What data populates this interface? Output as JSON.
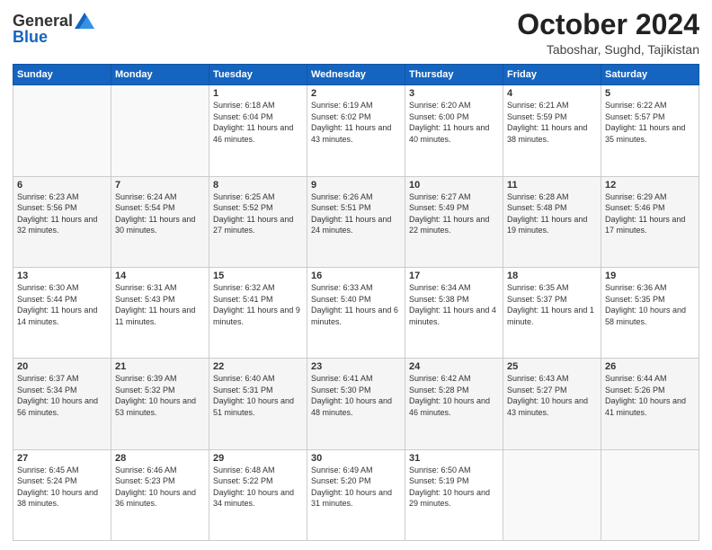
{
  "header": {
    "logo_general": "General",
    "logo_blue": "Blue",
    "title": "October 2024",
    "location": "Taboshar, Sughd, Tajikistan"
  },
  "days_of_week": [
    "Sunday",
    "Monday",
    "Tuesday",
    "Wednesday",
    "Thursday",
    "Friday",
    "Saturday"
  ],
  "weeks": [
    [
      {
        "day": null
      },
      {
        "day": null
      },
      {
        "day": 1,
        "sunrise": "6:18 AM",
        "sunset": "6:04 PM",
        "daylight": "11 hours and 46 minutes."
      },
      {
        "day": 2,
        "sunrise": "6:19 AM",
        "sunset": "6:02 PM",
        "daylight": "11 hours and 43 minutes."
      },
      {
        "day": 3,
        "sunrise": "6:20 AM",
        "sunset": "6:00 PM",
        "daylight": "11 hours and 40 minutes."
      },
      {
        "day": 4,
        "sunrise": "6:21 AM",
        "sunset": "5:59 PM",
        "daylight": "11 hours and 38 minutes."
      },
      {
        "day": 5,
        "sunrise": "6:22 AM",
        "sunset": "5:57 PM",
        "daylight": "11 hours and 35 minutes."
      }
    ],
    [
      {
        "day": 6,
        "sunrise": "6:23 AM",
        "sunset": "5:56 PM",
        "daylight": "11 hours and 32 minutes."
      },
      {
        "day": 7,
        "sunrise": "6:24 AM",
        "sunset": "5:54 PM",
        "daylight": "11 hours and 30 minutes."
      },
      {
        "day": 8,
        "sunrise": "6:25 AM",
        "sunset": "5:52 PM",
        "daylight": "11 hours and 27 minutes."
      },
      {
        "day": 9,
        "sunrise": "6:26 AM",
        "sunset": "5:51 PM",
        "daylight": "11 hours and 24 minutes."
      },
      {
        "day": 10,
        "sunrise": "6:27 AM",
        "sunset": "5:49 PM",
        "daylight": "11 hours and 22 minutes."
      },
      {
        "day": 11,
        "sunrise": "6:28 AM",
        "sunset": "5:48 PM",
        "daylight": "11 hours and 19 minutes."
      },
      {
        "day": 12,
        "sunrise": "6:29 AM",
        "sunset": "5:46 PM",
        "daylight": "11 hours and 17 minutes."
      }
    ],
    [
      {
        "day": 13,
        "sunrise": "6:30 AM",
        "sunset": "5:44 PM",
        "daylight": "11 hours and 14 minutes."
      },
      {
        "day": 14,
        "sunrise": "6:31 AM",
        "sunset": "5:43 PM",
        "daylight": "11 hours and 11 minutes."
      },
      {
        "day": 15,
        "sunrise": "6:32 AM",
        "sunset": "5:41 PM",
        "daylight": "11 hours and 9 minutes."
      },
      {
        "day": 16,
        "sunrise": "6:33 AM",
        "sunset": "5:40 PM",
        "daylight": "11 hours and 6 minutes."
      },
      {
        "day": 17,
        "sunrise": "6:34 AM",
        "sunset": "5:38 PM",
        "daylight": "11 hours and 4 minutes."
      },
      {
        "day": 18,
        "sunrise": "6:35 AM",
        "sunset": "5:37 PM",
        "daylight": "11 hours and 1 minute."
      },
      {
        "day": 19,
        "sunrise": "6:36 AM",
        "sunset": "5:35 PM",
        "daylight": "10 hours and 58 minutes."
      }
    ],
    [
      {
        "day": 20,
        "sunrise": "6:37 AM",
        "sunset": "5:34 PM",
        "daylight": "10 hours and 56 minutes."
      },
      {
        "day": 21,
        "sunrise": "6:39 AM",
        "sunset": "5:32 PM",
        "daylight": "10 hours and 53 minutes."
      },
      {
        "day": 22,
        "sunrise": "6:40 AM",
        "sunset": "5:31 PM",
        "daylight": "10 hours and 51 minutes."
      },
      {
        "day": 23,
        "sunrise": "6:41 AM",
        "sunset": "5:30 PM",
        "daylight": "10 hours and 48 minutes."
      },
      {
        "day": 24,
        "sunrise": "6:42 AM",
        "sunset": "5:28 PM",
        "daylight": "10 hours and 46 minutes."
      },
      {
        "day": 25,
        "sunrise": "6:43 AM",
        "sunset": "5:27 PM",
        "daylight": "10 hours and 43 minutes."
      },
      {
        "day": 26,
        "sunrise": "6:44 AM",
        "sunset": "5:26 PM",
        "daylight": "10 hours and 41 minutes."
      }
    ],
    [
      {
        "day": 27,
        "sunrise": "6:45 AM",
        "sunset": "5:24 PM",
        "daylight": "10 hours and 38 minutes."
      },
      {
        "day": 28,
        "sunrise": "6:46 AM",
        "sunset": "5:23 PM",
        "daylight": "10 hours and 36 minutes."
      },
      {
        "day": 29,
        "sunrise": "6:48 AM",
        "sunset": "5:22 PM",
        "daylight": "10 hours and 34 minutes."
      },
      {
        "day": 30,
        "sunrise": "6:49 AM",
        "sunset": "5:20 PM",
        "daylight": "10 hours and 31 minutes."
      },
      {
        "day": 31,
        "sunrise": "6:50 AM",
        "sunset": "5:19 PM",
        "daylight": "10 hours and 29 minutes."
      },
      {
        "day": null
      },
      {
        "day": null
      }
    ]
  ]
}
